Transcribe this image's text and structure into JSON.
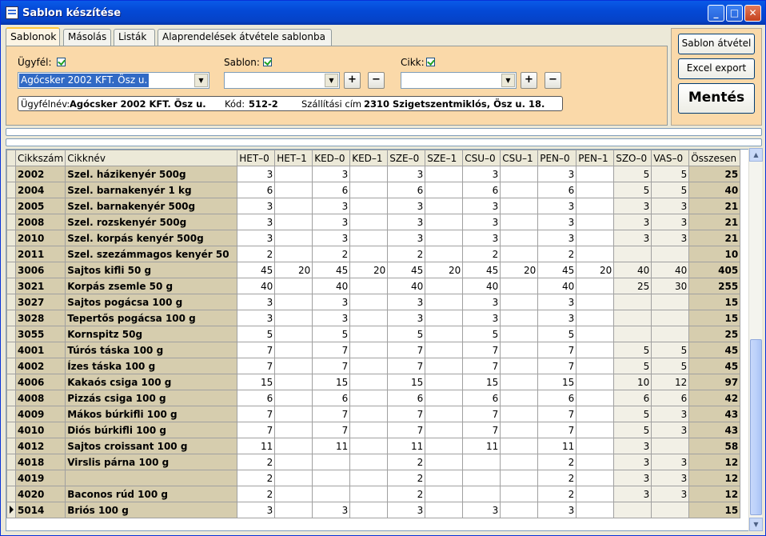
{
  "window": {
    "title": "Sablon készítése",
    "minimize": "_",
    "maximize": "□",
    "close": "✕"
  },
  "tabs": [
    "Sablonok",
    "Másolás",
    "Listák",
    "Alaprendelések átvétele sablonba"
  ],
  "filters": {
    "ugyfel_label": "Ügyfél:",
    "ugyfel_value": "Agócsker 2002 KFT.  Ösz u.",
    "sablon_label": "Sablon:",
    "sablon_value": "",
    "cikk_label": "Cikk:",
    "cikk_value": "",
    "plus": "+",
    "minus": "−"
  },
  "info": {
    "ugyfelnev_label": "Ügyfélnév:",
    "ugyfelnev_value": "Agócsker 2002 KFT.  Ösz u.",
    "kod_label": "Kód:",
    "kod_value": "512-2",
    "szallitasi_label": "Szállítási cím",
    "szallitasi_value": "2310 Szigetszentmiklós, Ösz u. 18."
  },
  "actions": {
    "sablon_atvetel": "Sablon átvétel",
    "excel_export": "Excel export",
    "mentes": "Mentés"
  },
  "table": {
    "columns": [
      "Cikkszám",
      "Cikknév",
      "HET–0",
      "HET–1",
      "KED–0",
      "KED–1",
      "SZE–0",
      "SZE–1",
      "CSU–0",
      "CSU–1",
      "PEN–0",
      "PEN–1",
      "SZO–0",
      "VAS–0",
      "Összesen"
    ],
    "rows": [
      [
        "2002",
        "Szel. házikenyér  500g",
        "3",
        "",
        "3",
        "",
        "3",
        "",
        "3",
        "",
        "3",
        "",
        "5",
        "5",
        "25"
      ],
      [
        "2004",
        "Szel. barnakenyér 1 kg",
        "6",
        "",
        "6",
        "",
        "6",
        "",
        "6",
        "",
        "6",
        "",
        "5",
        "5",
        "40"
      ],
      [
        "2005",
        "Szel. barnakenyér  500g",
        "3",
        "",
        "3",
        "",
        "3",
        "",
        "3",
        "",
        "3",
        "",
        "3",
        "3",
        "21"
      ],
      [
        "2008",
        "Szel. rozskenyér  500g",
        "3",
        "",
        "3",
        "",
        "3",
        "",
        "3",
        "",
        "3",
        "",
        "3",
        "3",
        "21"
      ],
      [
        "2010",
        "Szel. korpás kenyér  500g",
        "3",
        "",
        "3",
        "",
        "3",
        "",
        "3",
        "",
        "3",
        "",
        "3",
        "3",
        "21"
      ],
      [
        "2011",
        "Szel. szezámmagos kenyér  50",
        "2",
        "",
        "2",
        "",
        "2",
        "",
        "2",
        "",
        "2",
        "",
        "",
        "",
        "10"
      ],
      [
        "3006",
        "Sajtos kifli 50 g",
        "45",
        "20",
        "45",
        "20",
        "45",
        "20",
        "45",
        "20",
        "45",
        "20",
        "40",
        "40",
        "405"
      ],
      [
        "3021",
        "Korpás zsemle 50 g",
        "40",
        "",
        "40",
        "",
        "40",
        "",
        "40",
        "",
        "40",
        "",
        "25",
        "30",
        "255"
      ],
      [
        "3027",
        "Sajtos pogácsa 100 g",
        "3",
        "",
        "3",
        "",
        "3",
        "",
        "3",
        "",
        "3",
        "",
        "",
        "",
        "15"
      ],
      [
        "3028",
        "Tepertős pogácsa 100 g",
        "3",
        "",
        "3",
        "",
        "3",
        "",
        "3",
        "",
        "3",
        "",
        "",
        "",
        "15"
      ],
      [
        "3055",
        "Kornspitz 50g",
        "5",
        "",
        "5",
        "",
        "5",
        "",
        "5",
        "",
        "5",
        "",
        "",
        "",
        "25"
      ],
      [
        "4001",
        "Túrós táska 100 g",
        "7",
        "",
        "7",
        "",
        "7",
        "",
        "7",
        "",
        "7",
        "",
        "5",
        "5",
        "45"
      ],
      [
        "4002",
        "Ízes táska 100 g",
        "7",
        "",
        "7",
        "",
        "7",
        "",
        "7",
        "",
        "7",
        "",
        "5",
        "5",
        "45"
      ],
      [
        "4006",
        "Kakaós csiga 100 g",
        "15",
        "",
        "15",
        "",
        "15",
        "",
        "15",
        "",
        "15",
        "",
        "10",
        "12",
        "97"
      ],
      [
        "4008",
        "Pizzás csiga 100 g",
        "6",
        "",
        "6",
        "",
        "6",
        "",
        "6",
        "",
        "6",
        "",
        "6",
        "6",
        "42"
      ],
      [
        "4009",
        "Mákos búrkifli 100 g",
        "7",
        "",
        "7",
        "",
        "7",
        "",
        "7",
        "",
        "7",
        "",
        "5",
        "3",
        "43"
      ],
      [
        "4010",
        "Diós búrkifli 100 g",
        "7",
        "",
        "7",
        "",
        "7",
        "",
        "7",
        "",
        "7",
        "",
        "5",
        "3",
        "43"
      ],
      [
        "4012",
        "Sajtos croissant 100 g",
        "11",
        "",
        "11",
        "",
        "11",
        "",
        "11",
        "",
        "11",
        "",
        "3",
        "",
        "58"
      ],
      [
        "4018",
        "Virslis párna 100 g",
        "2",
        "",
        "",
        "",
        "2",
        "",
        "",
        "",
        "2",
        "",
        "3",
        "3",
        "12"
      ],
      [
        "4019",
        "",
        "2",
        "",
        "",
        "",
        "2",
        "",
        "",
        "",
        "2",
        "",
        "3",
        "3",
        "12"
      ],
      [
        "4020",
        "Baconos rúd 100 g",
        "2",
        "",
        "",
        "",
        "2",
        "",
        "",
        "",
        "2",
        "",
        "3",
        "3",
        "12"
      ],
      [
        "5014",
        "Briós 100 g",
        "3",
        "",
        "3",
        "",
        "3",
        "",
        "3",
        "",
        "3",
        "",
        "",
        "",
        "15"
      ]
    ],
    "current_row": 21
  }
}
